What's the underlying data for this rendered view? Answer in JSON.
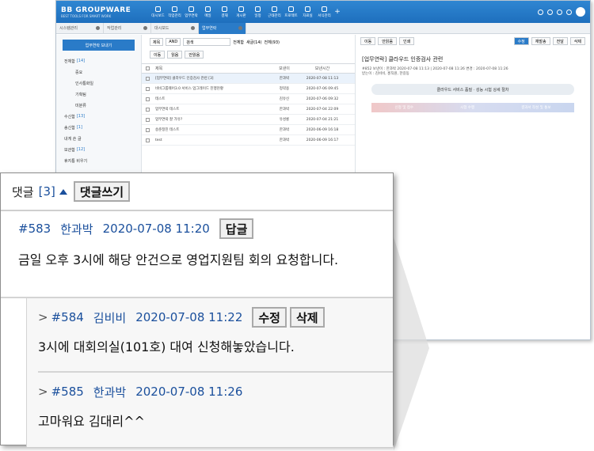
{
  "app": {
    "logo": "BB GROUPWARE",
    "logo_sub": "BEST TOOLS FOR SMART WORK",
    "menu": [
      "대시보드",
      "작업관리",
      "업무연락",
      "메일",
      "결재",
      "게시판",
      "일정",
      "근태관리",
      "프로젝트",
      "자료실",
      "서식관리"
    ],
    "tabs": [
      "시스템관리",
      "작업관리",
      "대시보드",
      "업무연락"
    ],
    "send_button": "업무연락 보내기",
    "tree": [
      {
        "label": "전체함",
        "count": "[14]"
      },
      {
        "label": "중요",
        "count": ""
      },
      {
        "label": "인사통화일",
        "count": ""
      },
      {
        "label": "기획팀",
        "count": ""
      },
      {
        "label": "미분류",
        "count": ""
      },
      {
        "label": "수신함",
        "count": "[13]"
      },
      {
        "label": "송신함",
        "count": "[1]"
      },
      {
        "label": "내게 쓴 글",
        "count": ""
      },
      {
        "label": "보관함",
        "count": "[12]"
      },
      {
        "label": "휴지통 비우기",
        "count": ""
      }
    ],
    "search": {
      "field": "제목",
      "op": "AND",
      "placeholder": "검색",
      "all_label": "전체함",
      "radio1": "새글(14)",
      "radio2": "전체(93)"
    },
    "list_buttons": [
      "이동",
      "읽음",
      "안읽음"
    ],
    "delete": "삭제",
    "columns": [
      "제목",
      "보낸이",
      "보낸시간"
    ],
    "rows": [
      {
        "title": "[업무연락] 클라우드 인증검사 관련 [3]",
        "sender": "한과박",
        "time": "2020-07-08 11:13"
      },
      {
        "title": "비비그룹웨어3.0 서비스 업그레이드 진행현황",
        "sender": "정약용",
        "time": "2020-07-06 09:45"
      },
      {
        "title": "테스트",
        "sender": "김유신",
        "time": "2020-07-06 09:32"
      },
      {
        "title": "업무연락 테스트",
        "sender": "한과박",
        "time": "2020-07-04 22:09"
      },
      {
        "title": "업무연락 잘 가유?",
        "sender": "유성룡",
        "time": "2020-07-04 21:21"
      },
      {
        "title": "송준정진 테스트",
        "sender": "한과박",
        "time": "2020-06-09 16:18"
      },
      {
        "title": "test",
        "sender": "한과박",
        "time": "2020-06-09 16:17"
      }
    ],
    "view_buttons_left": [
      "이동",
      "안읽음",
      "인쇄"
    ],
    "view_buttons_right": [
      "수정",
      "재발송",
      "전달",
      "삭제"
    ],
    "view_title": "[업무연락] 클라우드 인증검사 관련",
    "view_meta": "#852  보낸이 : 한과박  2020-07-08 11:13 | 2020-07-08 11:26 변경 : 2020-07-08 11:26",
    "view_meta2": "받는이 : 김비비, 홍직원, 한길동",
    "banner": "클라우드 서비스 품질 · 성능 시험 상세 절차",
    "flow": [
      "신청 및 접수",
      "시험 수행",
      "결과서 작성 및 통보"
    ]
  },
  "comments": {
    "title": "댓글",
    "count": "[3]",
    "write_button": "댓글쓰기",
    "items": [
      {
        "id": "#583",
        "author": "한과박",
        "time": "2020-07-08 11:20",
        "button": "답글",
        "body": "금일 오후 3시에 해당 안건으로 영업지원팀 회의 요청합니다."
      }
    ],
    "replies": [
      {
        "prefix": ">",
        "id": "#584",
        "author": "김비비",
        "time": "2020-07-08 11:22",
        "edit": "수정",
        "delete": "삭제",
        "body": "3시에 대회의실(101호) 대여 신청해놓았습니다."
      },
      {
        "prefix": ">",
        "id": "#585",
        "author": "한과박",
        "time": "2020-07-08 11:26",
        "body": "고마워요 김대리^^"
      }
    ]
  }
}
